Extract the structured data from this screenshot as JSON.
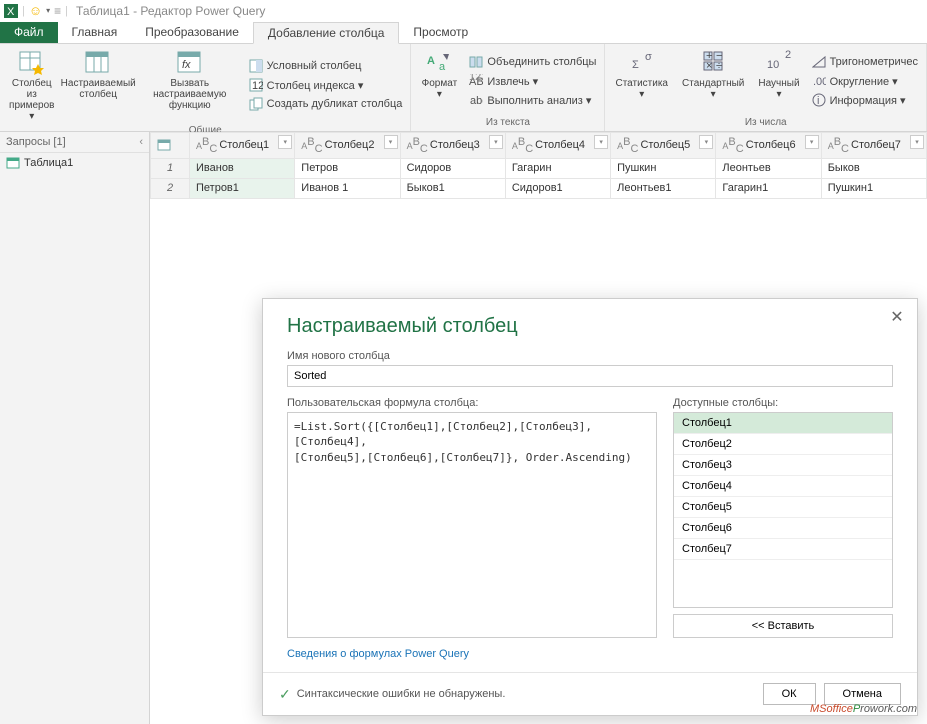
{
  "titlebar": {
    "text": "Таблица1 - Редактор Power Query"
  },
  "tabs": {
    "file": "Файл",
    "items": [
      "Главная",
      "Преобразование",
      "Добавление столбца",
      "Просмотр"
    ],
    "activeIndex": 2
  },
  "ribbon": {
    "group1": {
      "label": "Общие",
      "btn_examples": "Столбец из\nпримеров ▾",
      "btn_custom": "Настраиваемый\nстолбец",
      "btn_function": "Вызвать настраиваемую\nфункцию",
      "btn_conditional": "Условный столбец",
      "btn_index": "Столбец индекса ▾",
      "btn_duplicate": "Создать дубликат столбца"
    },
    "group2": {
      "label": "Из текста",
      "btn_format": "Формат\n▾",
      "btn_merge": "Объединить столбцы",
      "btn_extract": "Извлечь ▾",
      "btn_parse": "Выполнить анализ ▾"
    },
    "group3": {
      "label": "Из числа",
      "btn_stats": "Статистика\n▾",
      "btn_standard": "Стандартный\n▾",
      "btn_scientific": "Научный\n▾",
      "btn_trig": "Тригонометричес",
      "btn_round": "Округление ▾",
      "btn_info": "Информация ▾"
    }
  },
  "sidebar": {
    "header": "Запросы [1]",
    "items": [
      "Таблица1"
    ]
  },
  "grid": {
    "columns": [
      "Столбец1",
      "Столбец2",
      "Столбец3",
      "Столбец4",
      "Столбец5",
      "Столбец6",
      "Столбец7"
    ],
    "rows": [
      [
        "Иванов",
        "Петров",
        "Сидоров",
        "Гагарин",
        "Пушкин",
        "Леонтьев",
        "Быков"
      ],
      [
        "Петров1",
        "Иванов 1",
        "Быков1",
        "Сидоров1",
        "Леонтьев1",
        "Гагарин1",
        "Пушкин1"
      ]
    ]
  },
  "dialog": {
    "title": "Настраиваемый столбец",
    "name_label": "Имя нового столбца",
    "name_value": "Sorted",
    "formula_label": "Пользовательская формула столбца:",
    "formula_value": "=List.Sort({[Столбец1],[Столбец2],[Столбец3],[Столбец4],\n[Столбец5],[Столбец6],[Столбец7]}, Order.Ascending)",
    "avail_label": "Доступные столбцы:",
    "avail_items": [
      "Столбец1",
      "Столбец2",
      "Столбец3",
      "Столбец4",
      "Столбец5",
      "Столбец6",
      "Столбец7"
    ],
    "insert_btn": "<< Вставить",
    "link": "Сведения о формулах Power Query",
    "status": "Синтаксические ошибки не обнаружены.",
    "ok": "ОК",
    "cancel": "Отмена"
  },
  "watermark": {
    "a": "MSoffice",
    "b": "P",
    "c": "rowork.com"
  }
}
